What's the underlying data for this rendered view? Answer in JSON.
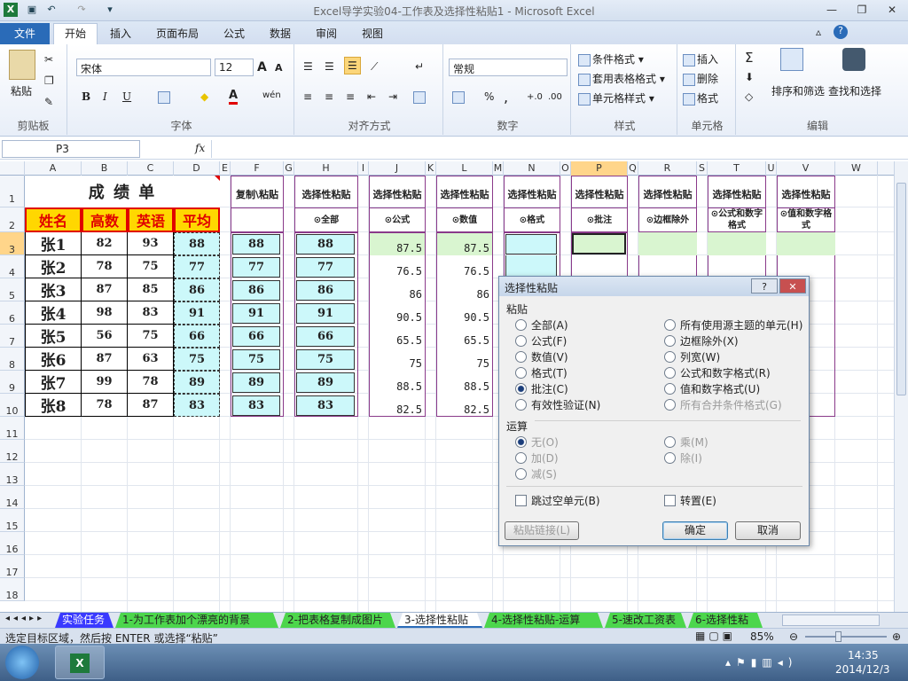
{
  "window": {
    "title": "Excel导学实验04-工作表及选择性粘贴1  -  Microsoft Excel",
    "undo_icon": "undo-icon",
    "redo_icon": "redo-icon",
    "min_icon": "minimize-icon",
    "max_icon": "restore-icon",
    "close_icon": "close-icon"
  },
  "tabs": [
    "文件",
    "开始",
    "插入",
    "页面布局",
    "公式",
    "数据",
    "审阅",
    "视图"
  ],
  "ribbon": {
    "clipboard": {
      "label": "剪贴板",
      "paste": "粘贴"
    },
    "font": {
      "label": "字体",
      "name": "宋体",
      "size": "12",
      "bold": "B",
      "italic": "I",
      "underline": "U",
      "grow": "A",
      "shrink": "A",
      "fontcolor": "A",
      "wen": "wén"
    },
    "align": {
      "label": "对齐方式"
    },
    "number": {
      "label": "数字",
      "format": "常规",
      "percent": "%",
      "comma": ",",
      "inc": "+.0",
      "dec": ".00"
    },
    "styles": {
      "label": "样式",
      "cond": "条件格式",
      "table": "套用表格格式",
      "cell": "单元格样式"
    },
    "cells": {
      "label": "单元格",
      "insert": "插入",
      "delete": "删除",
      "format": "格式"
    },
    "edit": {
      "label": "编辑",
      "sigma": "Σ",
      "sort": "排序和筛选",
      "find": "查找和选择"
    }
  },
  "formula": {
    "cell": "P3",
    "fx": "fx",
    "value": ""
  },
  "columns": [
    "A",
    "B",
    "C",
    "D",
    "E",
    "F",
    "G",
    "H",
    "I",
    "J",
    "K",
    "L",
    "M",
    "N",
    "O",
    "P",
    "Q",
    "R",
    "S",
    "T",
    "U",
    "V",
    "W"
  ],
  "rows": [
    "1",
    "2",
    "3",
    "4",
    "5",
    "6",
    "7",
    "8",
    "9",
    "10",
    "11",
    "12",
    "13",
    "14",
    "15",
    "16",
    "17",
    "18"
  ],
  "sheet": {
    "title": "成 绩 单",
    "headers": [
      "姓名",
      "高数",
      "英语",
      "平均"
    ],
    "students": [
      {
        "name": "张1",
        "math": "82",
        "eng": "93",
        "avg": "88"
      },
      {
        "name": "张2",
        "math": "78",
        "eng": "75",
        "avg": "77"
      },
      {
        "name": "张3",
        "math": "87",
        "eng": "85",
        "avg": "86"
      },
      {
        "name": "张4",
        "math": "98",
        "eng": "83",
        "avg": "91"
      },
      {
        "name": "张5",
        "math": "56",
        "eng": "75",
        "avg": "66"
      },
      {
        "name": "张6",
        "math": "87",
        "eng": "63",
        "avg": "75"
      },
      {
        "name": "张7",
        "math": "99",
        "eng": "78",
        "avg": "89"
      },
      {
        "name": "张8",
        "math": "78",
        "eng": "87",
        "avg": "83"
      }
    ],
    "col_titles": {
      "F": "复制\\粘贴",
      "H": "选择性粘贴",
      "J": "选择性粘贴",
      "L": "选择性粘贴",
      "N": "选择性粘贴",
      "P": "选择性粘贴",
      "R": "选择性粘贴",
      "T": "选择性粘贴",
      "V": "选择性粘贴"
    },
    "col_subs": {
      "H": "⊙全部",
      "J": "⊙公式",
      "L": "⊙数值",
      "N": "⊙格式",
      "P": "⊙批注",
      "R": "⊙边框除外",
      "T": "⊙公式和数字格式",
      "V": "⊙值和数字格式"
    },
    "decimals": [
      "87.5",
      "76.5",
      "86",
      "90.5",
      "65.5",
      "75",
      "88.5",
      "82.5"
    ]
  },
  "sheet_tabs": [
    {
      "label": "实验任务",
      "color": "#3a3aff",
      "text": "#fff"
    },
    {
      "label": "1-为工作表加个漂亮的背景",
      "color": "#4cd64c",
      "text": "#222"
    },
    {
      "label": "2-把表格复制成图片",
      "color": "#4cd64c",
      "text": "#222"
    },
    {
      "label": "3-选择性粘贴",
      "color": "#ffffff",
      "text": "#222"
    },
    {
      "label": "4-选择性粘贴-运算",
      "color": "#4cd64c",
      "text": "#222"
    },
    {
      "label": "5-速改工资表",
      "color": "#4cd64c",
      "text": "#222"
    },
    {
      "label": "6-选择性粘",
      "color": "#4cd64c",
      "text": "#222"
    }
  ],
  "status": {
    "message": "选定目标区域，然后按 ENTER 或选择“粘贴”",
    "zoom": "85%"
  },
  "taskbar": {
    "time": "14:35",
    "date": "2014/12/3"
  },
  "dialog": {
    "title": "选择性粘贴",
    "help": "?",
    "close": "✕",
    "paste_label": "粘贴",
    "paste_left": [
      "全部(A)",
      "公式(F)",
      "数值(V)",
      "格式(T)",
      "批注(C)",
      "有效性验证(N)"
    ],
    "paste_right": [
      "所有使用源主题的单元(H)",
      "边框除外(X)",
      "列宽(W)",
      "公式和数字格式(R)",
      "值和数字格式(U)",
      "所有合并条件格式(G)"
    ],
    "op_label": "运算",
    "op_left": [
      "无(O)",
      "加(D)",
      "减(S)"
    ],
    "op_right": [
      "乘(M)",
      "除(I)"
    ],
    "skip_blanks": "跳过空单元(B)",
    "transpose": "转置(E)",
    "paste_link": "粘贴链接(L)",
    "ok": "确定",
    "cancel": "取消"
  }
}
